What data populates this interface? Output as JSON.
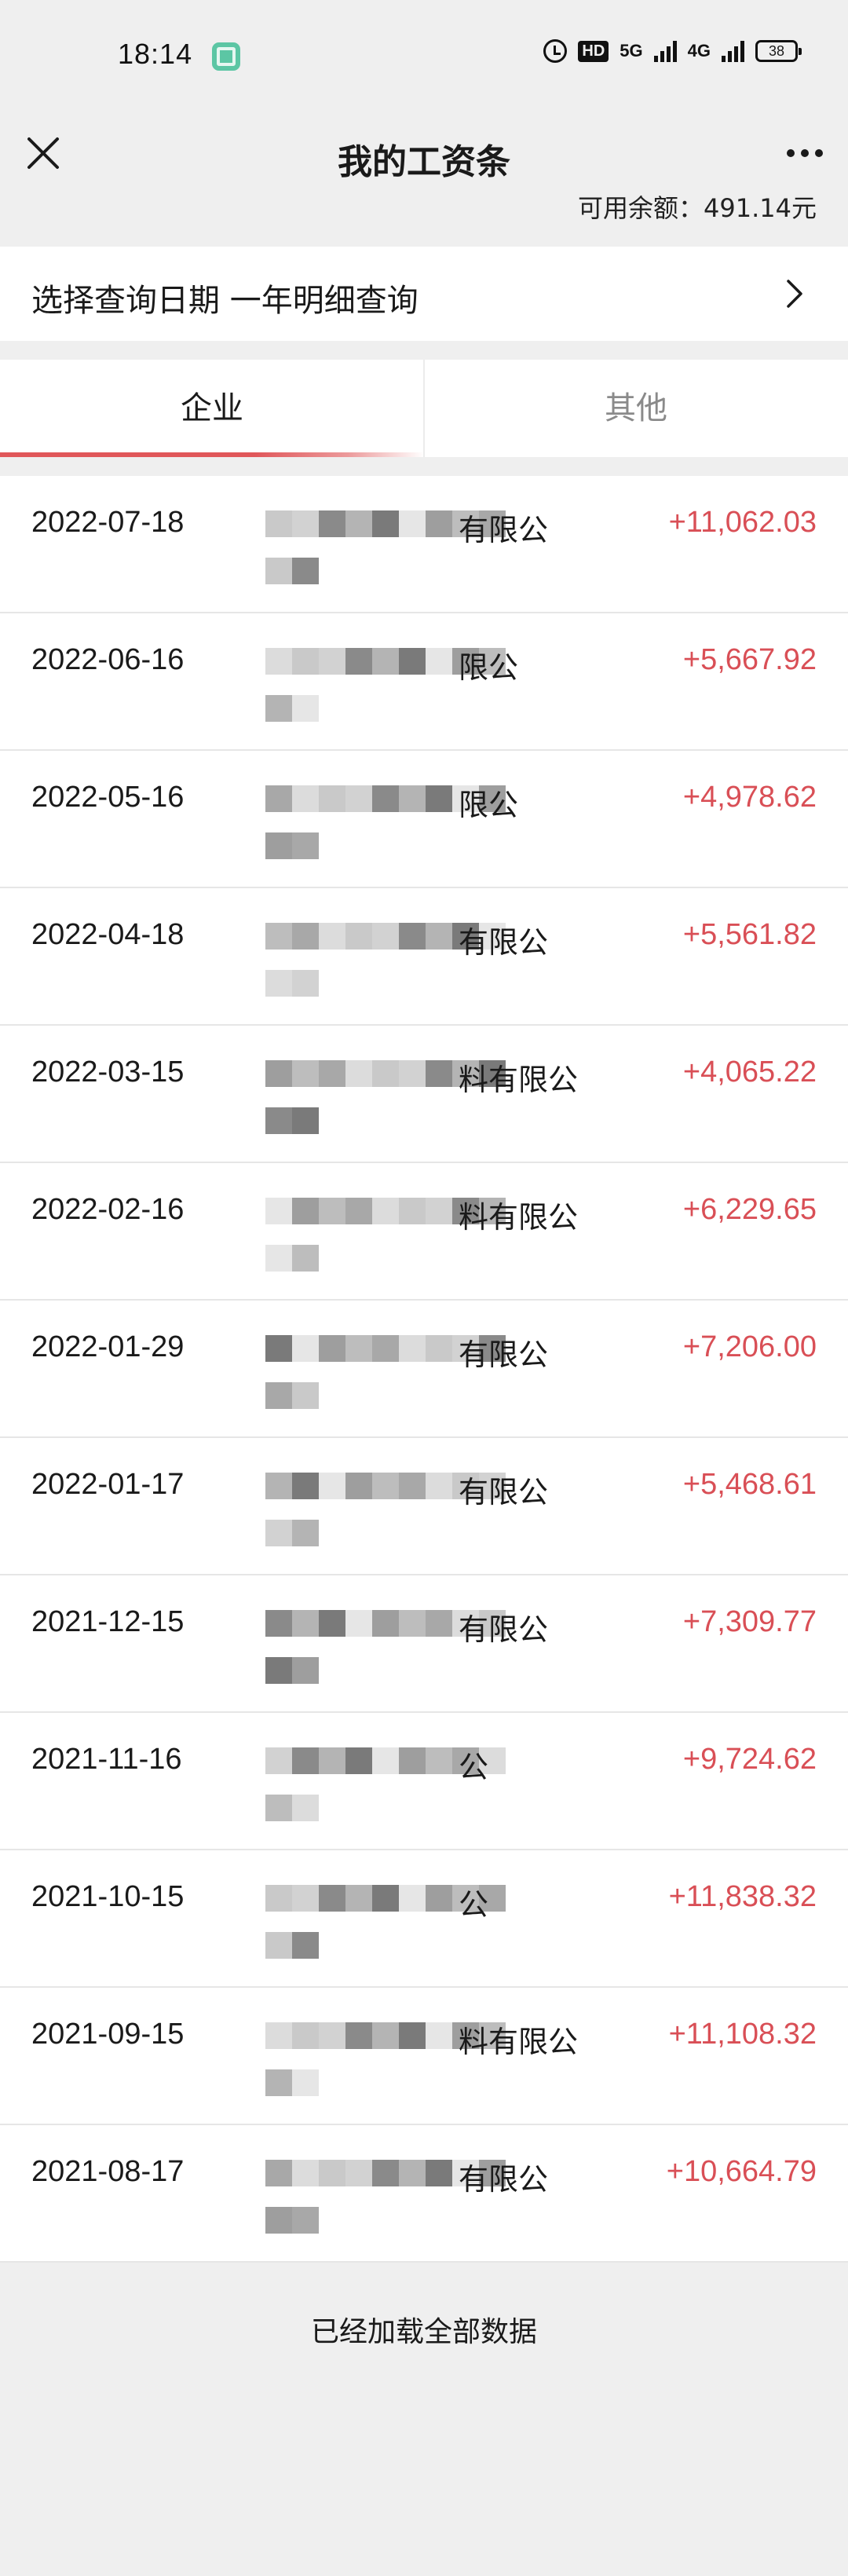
{
  "status_bar": {
    "time": "18:14",
    "hd_label": "HD",
    "network_1": "5G",
    "network_2": "4G",
    "battery": "38"
  },
  "nav": {
    "title": "我的工资条"
  },
  "balance": {
    "label": "可用余额：491.14元"
  },
  "date_selector": {
    "label": "选择查询日期 一年明细查询"
  },
  "tabs": [
    {
      "label": "企业",
      "active": true
    },
    {
      "label": "其他",
      "active": false
    }
  ],
  "colors": {
    "accent": "#e0575a",
    "amount": "#d94f56"
  },
  "records": [
    {
      "date": "2022-07-18",
      "company_visible": "有限公",
      "amount": "+11,062.03"
    },
    {
      "date": "2022-06-16",
      "company_visible": "限公",
      "amount": "+5,667.92"
    },
    {
      "date": "2022-05-16",
      "company_visible": "限公",
      "amount": "+4,978.62"
    },
    {
      "date": "2022-04-18",
      "company_visible": "有限公",
      "amount": "+5,561.82"
    },
    {
      "date": "2022-03-15",
      "company_visible": "料有限公",
      "amount": "+4,065.22"
    },
    {
      "date": "2022-02-16",
      "company_visible": "料有限公",
      "amount": "+6,229.65"
    },
    {
      "date": "2022-01-29",
      "company_visible": "有限公",
      "amount": "+7,206.00"
    },
    {
      "date": "2022-01-17",
      "company_visible": "有限公",
      "amount": "+5,468.61"
    },
    {
      "date": "2021-12-15",
      "company_visible": "有限公",
      "amount": "+7,309.77"
    },
    {
      "date": "2021-11-16",
      "company_visible": "公",
      "amount": "+9,724.62"
    },
    {
      "date": "2021-10-15",
      "company_visible": "公",
      "amount": "+11,838.32"
    },
    {
      "date": "2021-09-15",
      "company_visible": "料有限公",
      "amount": "+11,108.32"
    },
    {
      "date": "2021-08-17",
      "company_visible": "有限公",
      "amount": "+10,664.79"
    }
  ],
  "footer": {
    "text": "已经加载全部数据"
  }
}
